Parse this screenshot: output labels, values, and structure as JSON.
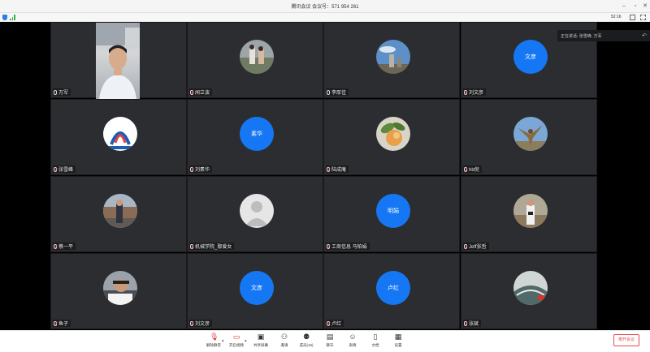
{
  "window": {
    "title": "腾讯会议 会议号：571 954 261"
  },
  "status": {
    "timer": "52:16"
  },
  "speaker_panel": {
    "label": "正在讲话: 张雪峰; 万军"
  },
  "participants": [
    {
      "name": "万军"
    },
    {
      "name": "闻立波"
    },
    {
      "name": "李厚佳"
    },
    {
      "name": "刘文彦",
      "initials": "文彦"
    },
    {
      "name": "张雪峰"
    },
    {
      "name": "刘素华",
      "initials": "素华"
    },
    {
      "name": "陆成庵"
    },
    {
      "name": "hb倪"
    },
    {
      "name": "蔡一平"
    },
    {
      "name": "机械学院_鄢爱女"
    },
    {
      "name": "工商信息  马柏娟",
      "initials": "明娟"
    },
    {
      "name": "Jeff张哲"
    },
    {
      "name": "鱼子"
    },
    {
      "name": "刘文彦",
      "initials": "文彦"
    },
    {
      "name": "卢红",
      "initials": "卢红"
    },
    {
      "name": "张斌"
    }
  ],
  "toolbar": {
    "unmute": "解除静音",
    "video": "开启视频",
    "share": "共享屏幕",
    "invite": "邀请",
    "members": "成员(16)",
    "chat": "聊天",
    "reactions": "表情",
    "docs": "文档",
    "settings": "设置",
    "leave": "离开会议"
  },
  "colors": {
    "initials_bg": "#1677f5",
    "leave": "#e84c4c",
    "tile_bg": "#2c2d30"
  }
}
